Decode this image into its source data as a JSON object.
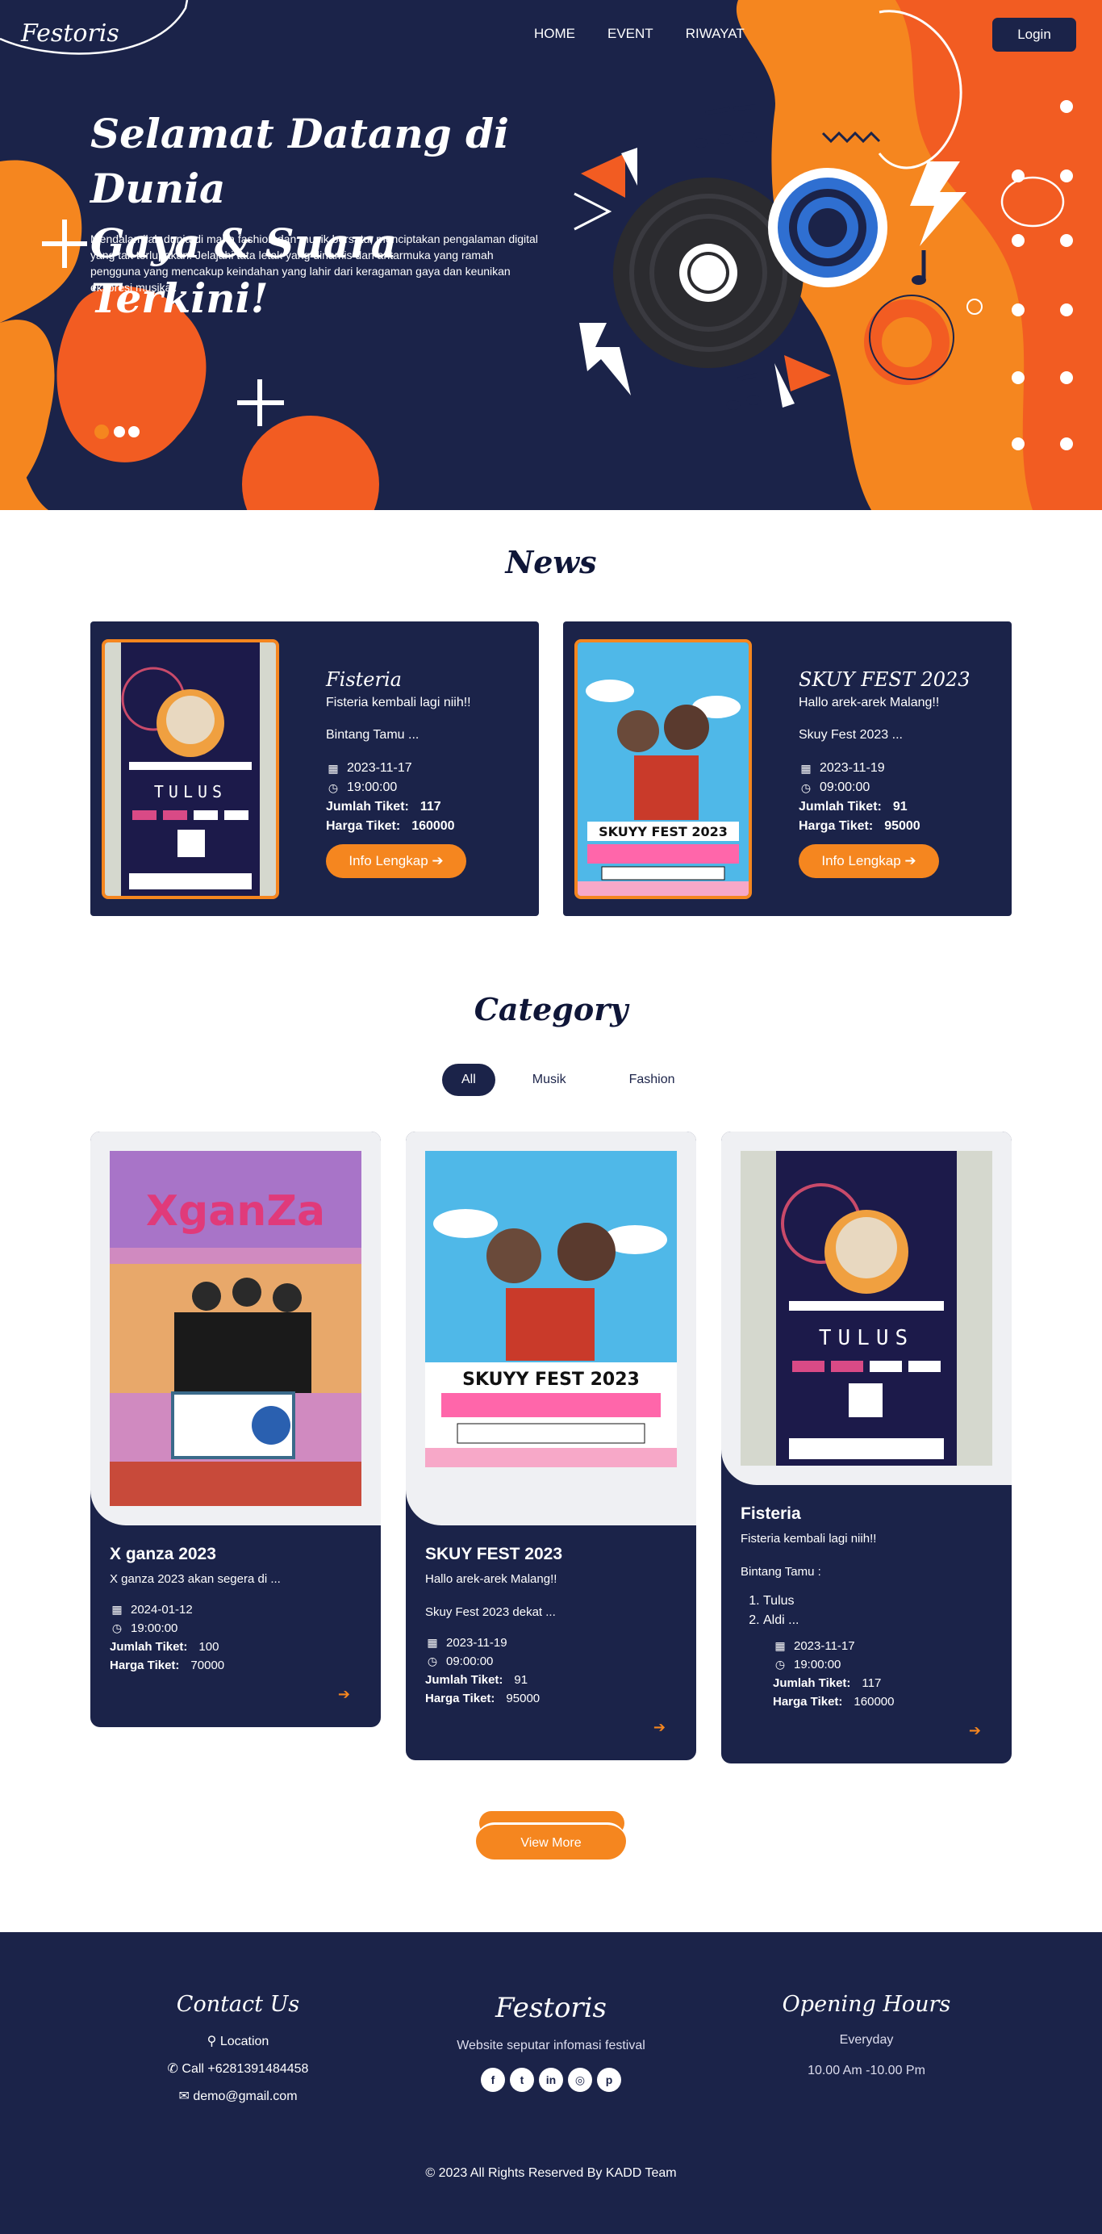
{
  "nav": {
    "brand": "Festoris",
    "menu": [
      "HOME",
      "EVENT",
      "RIWAYAT"
    ],
    "login": "Login"
  },
  "hero": {
    "title_line1": "Selamat Datang di Dunia",
    "title_line2": "Gaya & Suara Terkini!",
    "text": "Mendalamilah dunia di mana fashion dan musik bersatu, menciptakan pengalaman digital yang tak terlupakan. Jelajahi tata letak yang dinamis dan antarmuka yang ramah pengguna yang mencakup keindahan yang lahir dari keragaman gaya dan keunikan ekspresi musikal."
  },
  "news": {
    "title": "News",
    "cards": [
      {
        "name": "Fisteria",
        "desc": "Fisteria kembali lagi niih!!",
        "guest": "Bintang Tamu ...",
        "date": "2023-11-17",
        "time": "19:00:00",
        "ticket_label": "Jumlah Tiket:",
        "ticket": "117",
        "price_label": "Harga Tiket:",
        "price": "160000",
        "button": "Info Lengkap ➔",
        "poster_text": "TULUS"
      },
      {
        "name": "SKUY FEST 2023",
        "desc": "Hallo arek-arek Malang!!",
        "guest": "Skuy Fest 2023 ...",
        "date": "2023-11-19",
        "time": "09:00:00",
        "ticket_label": "Jumlah Tiket:",
        "ticket": "91",
        "price_label": "Harga Tiket:",
        "price": "95000",
        "button": "Info Lengkap ➔",
        "poster_text": "SKUYY FEST 2023"
      }
    ]
  },
  "category": {
    "title": "Category",
    "filters": [
      "All",
      "Musik",
      "Fashion"
    ],
    "cards": [
      {
        "name": "X ganza 2023",
        "desc": "X ganza 2023 akan segera di ...",
        "date": "2024-01-12",
        "time": "19:00:00",
        "ticket_label": "Jumlah Tiket:",
        "ticket": "100",
        "price_label": "Harga Tiket:",
        "price": "70000",
        "poster_text": "XganZa"
      },
      {
        "name": "SKUY FEST 2023",
        "desc": "Hallo arek-arek Malang!!",
        "guest": "Skuy Fest 2023 dekat ...",
        "date": "2023-11-19",
        "time": "09:00:00",
        "ticket_label": "Jumlah Tiket:",
        "ticket": "91",
        "price_label": "Harga Tiket:",
        "price": "95000",
        "poster_text": "SKUYY FEST 2023"
      },
      {
        "name": "Fisteria",
        "desc": "Fisteria kembali lagi niih!!",
        "guest": "Bintang Tamu :",
        "list": [
          "Tulus",
          "Aldi ..."
        ],
        "date": "2023-11-17",
        "time": "19:00:00",
        "ticket_label": "Jumlah Tiket:",
        "ticket": "117",
        "price_label": "Harga Tiket:",
        "price": "160000",
        "poster_text": "TULUS"
      }
    ],
    "view_more": "View More"
  },
  "footer": {
    "contact_title": "Contact Us",
    "location": "Location",
    "phone": "Call +6281391484458",
    "email": "demo@gmail.com",
    "brand": "Festoris",
    "brand_sub": "Website seputar infomasi festival",
    "socials": [
      "facebook-icon",
      "twitter-icon",
      "linkedin-icon",
      "instagram-icon",
      "pinterest-icon"
    ],
    "hours_title": "Opening Hours",
    "hours_days": "Everyday",
    "hours_time": "10.00 Am -10.00 Pm",
    "copyright": "© 2023 All Rights Reserved By KADD Team"
  },
  "colors": {
    "navy": "#1b2349",
    "orange": "#f5861f",
    "red_orange": "#f25c22"
  }
}
